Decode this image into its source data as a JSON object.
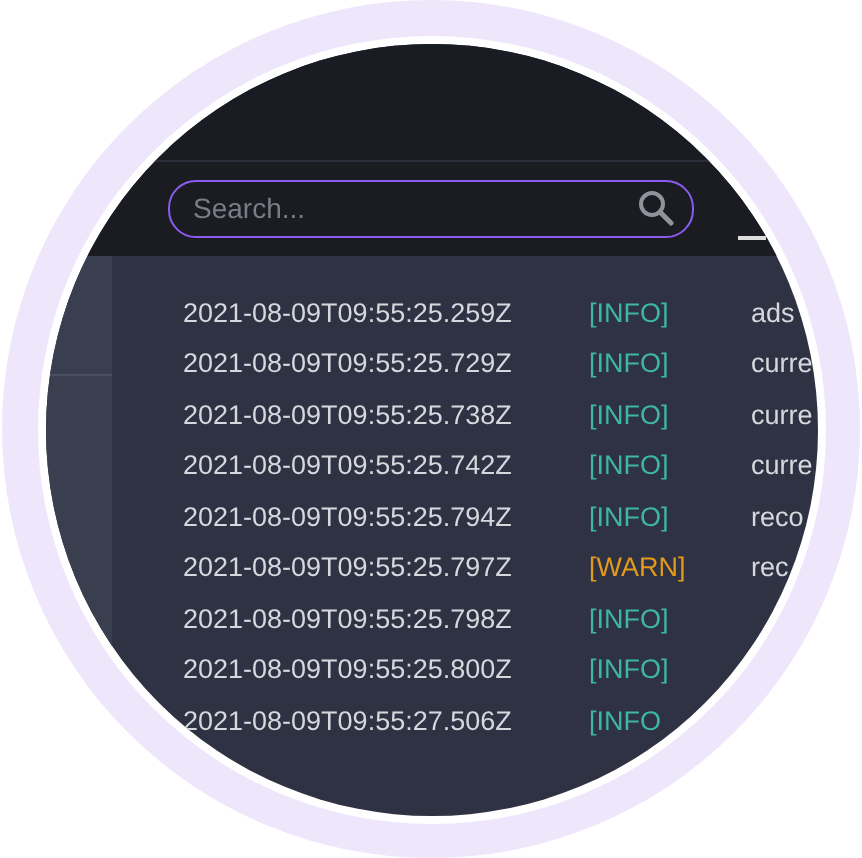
{
  "search": {
    "placeholder": "Search..."
  },
  "log": [
    {
      "timestamp": "2021-08-09T09:55:25.259Z",
      "level": "[INFO]",
      "kind": "info",
      "message": "ads"
    },
    {
      "timestamp": "2021-08-09T09:55:25.729Z",
      "level": "[INFO]",
      "kind": "info",
      "message": "curre"
    },
    {
      "timestamp": "2021-08-09T09:55:25.738Z",
      "level": "[INFO]",
      "kind": "info",
      "message": "curre"
    },
    {
      "timestamp": "2021-08-09T09:55:25.742Z",
      "level": "[INFO]",
      "kind": "info",
      "message": "curre"
    },
    {
      "timestamp": "2021-08-09T09:55:25.794Z",
      "level": "[INFO]",
      "kind": "info",
      "message": "reco"
    },
    {
      "timestamp": "2021-08-09T09:55:25.797Z",
      "level": "[WARN]",
      "kind": "warn",
      "message": "rec"
    },
    {
      "timestamp": "2021-08-09T09:55:25.798Z",
      "level": "[INFO]",
      "kind": "info"
    },
    {
      "timestamp": "2021-08-09T09:55:25.800Z",
      "level": "[INFO]",
      "kind": "info"
    },
    {
      "timestamp": "2021-08-09T09:55:27.506Z",
      "level": "[INFO",
      "kind": "info"
    }
  ]
}
